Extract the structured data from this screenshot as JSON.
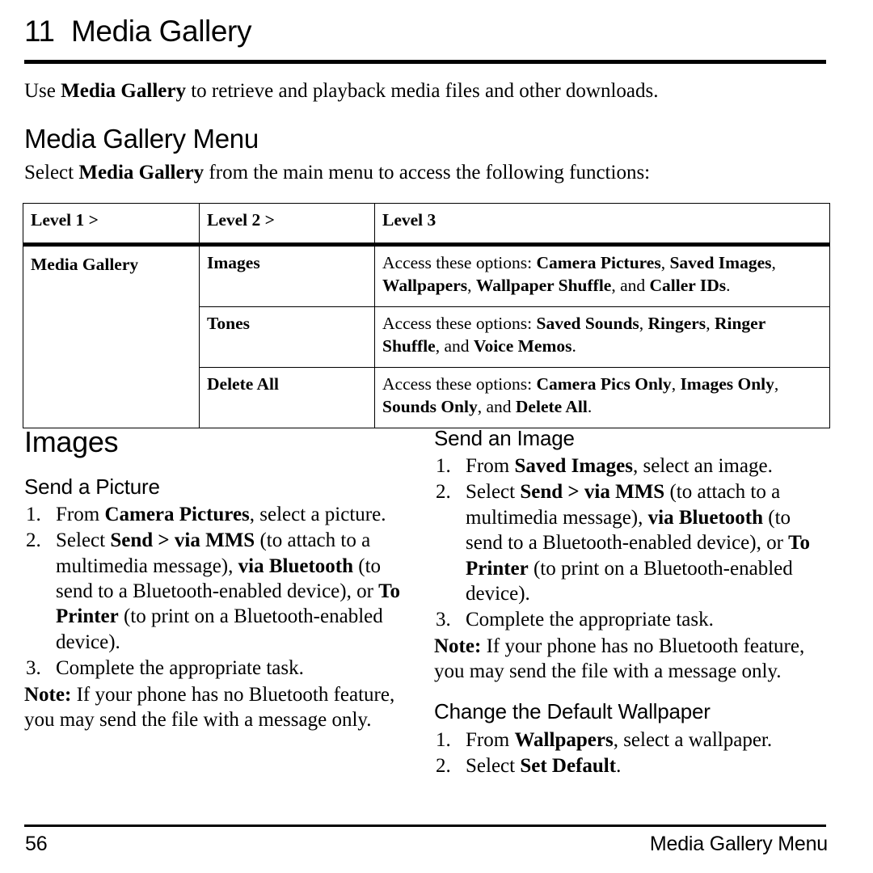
{
  "chapter": {
    "number": "11",
    "title": "Media Gallery"
  },
  "intro": {
    "before": "Use ",
    "bold": "Media Gallery",
    "after": " to retrieve and playback media files and other downloads."
  },
  "menu_section": {
    "heading": "Media Gallery Menu",
    "lead_before": "Select ",
    "lead_bold": "Media Gallery",
    "lead_after": " from the main menu to access the following functions:"
  },
  "table": {
    "headers": [
      "Level 1 >",
      "Level 2 >",
      "Level 3"
    ],
    "level1": "Media Gallery",
    "rows": [
      {
        "level2": "Images",
        "level3_prefix": "Access these options: ",
        "level3_options": [
          "Camera Pictures",
          "Saved Images",
          "Wallpapers",
          "Wallpaper Shuffle",
          "Caller IDs"
        ],
        "level3_full": "Access these options: Camera Pictures, Saved Images, Wallpapers, Wallpaper Shuffle, and Caller IDs."
      },
      {
        "level2": "Tones",
        "level3_prefix": "Access these options: ",
        "level3_options": [
          "Saved Sounds",
          "Ringers",
          "Ringer Shuffle",
          "Voice Memos"
        ],
        "level3_full": "Access these options: Saved Sounds, Ringers, Ringer Shuffle, and Voice Memos."
      },
      {
        "level2": "Delete All",
        "level3_prefix": "Access these options: ",
        "level3_options": [
          "Camera Pics Only",
          "Images Only",
          "Sounds Only",
          "Delete All"
        ],
        "level3_full": "Access these options: Camera Pics Only, Images Only, Sounds Only, and Delete All."
      }
    ]
  },
  "images_section": {
    "heading": "Images",
    "left": {
      "subheading": "Send a Picture",
      "steps": [
        {
          "parts": [
            {
              "text": "From ",
              "bold": false
            },
            {
              "text": "Camera Pictures",
              "bold": true
            },
            {
              "text": ", select a picture.",
              "bold": false
            }
          ]
        },
        {
          "parts": [
            {
              "text": "Select ",
              "bold": false
            },
            {
              "text": "Send > via MMS",
              "bold": true
            },
            {
              "text": " (to attach to a multimedia message), ",
              "bold": false
            },
            {
              "text": "via Bluetooth",
              "bold": true
            },
            {
              "text": " (to send to a Bluetooth-enabled device), or ",
              "bold": false
            },
            {
              "text": "To Printer",
              "bold": true
            },
            {
              "text": " (to print on a Bluetooth-enabled device).",
              "bold": false
            }
          ]
        },
        {
          "parts": [
            {
              "text": "Complete the appropriate task.",
              "bold": false
            }
          ]
        }
      ],
      "note_label": "Note:",
      "note_text": " If your phone has no Bluetooth feature, you may send the file with a message only."
    },
    "right": {
      "subheading_1": "Send an Image",
      "steps_1": [
        {
          "parts": [
            {
              "text": "From ",
              "bold": false
            },
            {
              "text": "Saved Images",
              "bold": true
            },
            {
              "text": ", select an image.",
              "bold": false
            }
          ]
        },
        {
          "parts": [
            {
              "text": "Select ",
              "bold": false
            },
            {
              "text": "Send > via MMS",
              "bold": true
            },
            {
              "text": " (to attach to a multimedia message), ",
              "bold": false
            },
            {
              "text": "via Bluetooth",
              "bold": true
            },
            {
              "text": " (to send to a Bluetooth-enabled device), or ",
              "bold": false
            },
            {
              "text": "To Printer",
              "bold": true
            },
            {
              "text": " (to print on a Bluetooth-enabled device).",
              "bold": false
            }
          ]
        },
        {
          "parts": [
            {
              "text": "Complete the appropriate task.",
              "bold": false
            }
          ]
        }
      ],
      "note_label": "Note:",
      "note_text": " If your phone has no Bluetooth feature, you may send the file with a message only.",
      "subheading_2": "Change the Default Wallpaper",
      "steps_2": [
        {
          "parts": [
            {
              "text": "From ",
              "bold": false
            },
            {
              "text": "Wallpapers",
              "bold": true
            },
            {
              "text": ", select a wallpaper.",
              "bold": false
            }
          ]
        },
        {
          "parts": [
            {
              "text": "Select ",
              "bold": false
            },
            {
              "text": "Set Default",
              "bold": true
            },
            {
              "text": ".",
              "bold": false
            }
          ]
        }
      ]
    }
  },
  "footer": {
    "page_number": "56",
    "running_title": "Media Gallery Menu"
  }
}
